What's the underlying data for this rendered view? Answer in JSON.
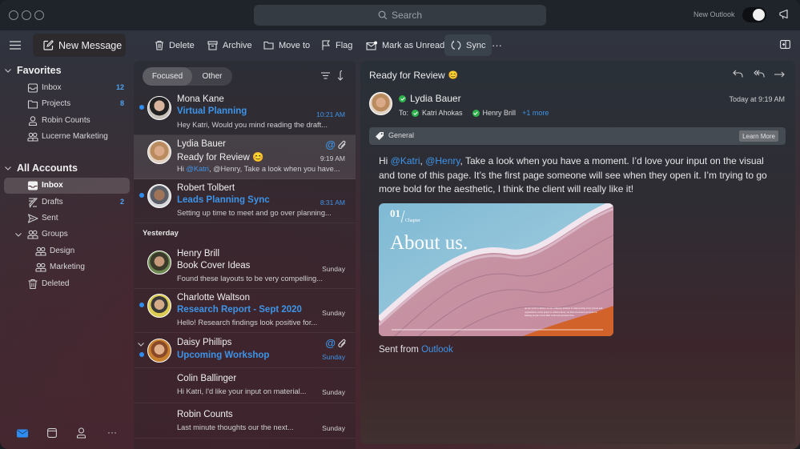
{
  "titlebar": {
    "search_placeholder": "Search",
    "new_outlook_label": "New Outlook",
    "new_outlook_enabled": true
  },
  "toolbar": {
    "new_message": "New Message",
    "delete": "Delete",
    "archive": "Archive",
    "move_to": "Move to",
    "flag": "Flag",
    "mark_unread": "Mark as Unread",
    "sync": "Sync",
    "more": "···"
  },
  "sidebar": {
    "favorites": {
      "title": "Favorites",
      "items": [
        {
          "label": "Inbox",
          "count": "12",
          "icon": "inbox-icon"
        },
        {
          "label": "Projects",
          "count": "8",
          "icon": "folder-icon"
        },
        {
          "label": "Robin Counts",
          "count": "",
          "icon": "person-icon"
        },
        {
          "label": "Lucerne Marketing",
          "count": "",
          "icon": "group-icon"
        }
      ]
    },
    "accounts": {
      "title": "All Accounts",
      "items": [
        {
          "label": "Inbox",
          "count": "",
          "icon": "inbox-icon",
          "active": true
        },
        {
          "label": "Drafts",
          "count": "2",
          "icon": "drafts-icon"
        },
        {
          "label": "Sent",
          "count": "",
          "icon": "sent-icon"
        },
        {
          "label": "Groups",
          "count": "",
          "icon": "group-icon",
          "expanded": true
        },
        {
          "label": "Design",
          "count": "",
          "icon": "group-icon",
          "sub": true
        },
        {
          "label": "Marketing",
          "count": "",
          "icon": "group-icon",
          "sub": true
        },
        {
          "label": "Deleted",
          "count": "",
          "icon": "trash-icon"
        }
      ]
    },
    "bottom_nav": [
      "mail-icon",
      "calendar-icon",
      "people-icon",
      "more-icon"
    ],
    "bottom_more": "···"
  },
  "message_list": {
    "tabs": {
      "focused": "Focused",
      "other": "Other",
      "active": "Focused"
    },
    "group_yesterday": "Yesterday",
    "messages": [
      {
        "from": "Mona Kane",
        "subject": "Virtual Planning",
        "preview": "Hey Katri, Would you mind reading the draft...",
        "time": "10:21 AM",
        "unread": true
      },
      {
        "from": "Lydia Bauer",
        "subject": "Ready for Review 😊",
        "preview_mention": "@Katri",
        "preview": ", @Henry, Take a look when you have...",
        "preview_prefix": "Hi ",
        "time": "9:19 AM",
        "unread": false,
        "selected": true,
        "mention": true,
        "attachment": true
      },
      {
        "from": "Robert Tolbert",
        "subject": "Leads Planning Sync",
        "preview": "Setting up time to meet and go over planning...",
        "time": "8:31 AM",
        "unread": true
      },
      {
        "from": "Henry Brill",
        "subject": "Book Cover Ideas",
        "preview": "Found these layouts to be very compelling...",
        "time": "Sunday",
        "unread": false
      },
      {
        "from": "Charlotte Waltson",
        "subject": "Research Report - Sept 2020",
        "preview": "Hello! Research findings look positive for...",
        "time": "Sunday",
        "unread": true
      },
      {
        "from": "Daisy Phillips",
        "subject": "Upcoming Workshop",
        "preview": "",
        "time": "Sunday",
        "unread": true,
        "mention": true,
        "attachment": true,
        "thread_collapsible": true
      },
      {
        "from": "Colin Ballinger",
        "subject": "",
        "preview": "Hi Katri, I'd like your input on material...",
        "time": "Sunday",
        "unread": false
      },
      {
        "from": "Robin Counts",
        "subject": "",
        "preview": "Last minute thoughts our the next...",
        "time": "Sunday",
        "unread": false
      }
    ]
  },
  "reading_pane": {
    "subject": "Ready for Review",
    "subject_emoji": "😊",
    "from": "Lydia Bauer",
    "to_label": "To:",
    "recipients": [
      "Katri Ahokas",
      "Henry Brill"
    ],
    "more_recipients": "+1 more",
    "date": "Today at 9:19 AM",
    "category": "General",
    "learn_more": "Learn More",
    "body": {
      "greeting": "Hi ",
      "mention1": "@Katri",
      "sep": ", ",
      "mention2": "@Henry",
      "text": ", Take a look when you have a moment. I’d love your input on the visual and tone of this page. It’s the first page someone will see when they open it. I’m trying to go more bold for the aesthetic, I think the client will really like it!"
    },
    "attachment_image": {
      "chapter_number": "01",
      "chapter_label": "Chapter",
      "heading": "About us.",
      "caption": "As we work to deliver on our company mission of empowering every person and organization on the planet to achieve more, we have increased our focus on helping people across their work and personal lives."
    },
    "signature_prefix": "Sent from ",
    "signature_link": "Outlook"
  },
  "colors": {
    "accent": "#3d94e8",
    "unread_dot": "#2f8cf0",
    "presence_available": "#2fb14b"
  }
}
